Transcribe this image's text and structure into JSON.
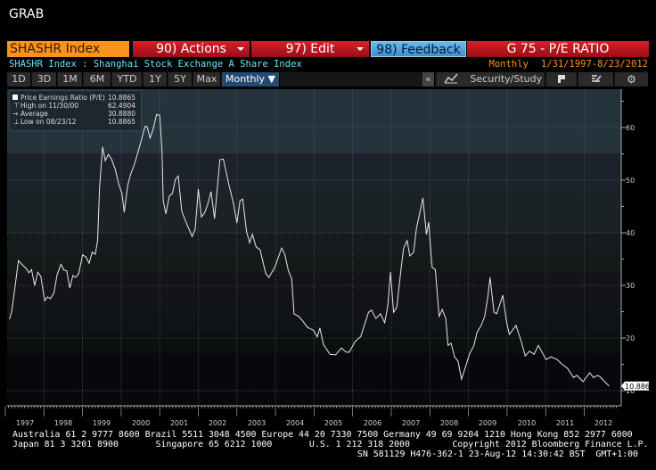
{
  "window_title": "GRAB",
  "toolbar": {
    "ticker": "SHASHR Index",
    "actions_label": "90) Actions",
    "edit_label": "97) Edit",
    "feedback_label": "98) Feedback",
    "function_title": "G 75 - P/E RATIO"
  },
  "subheader": {
    "description": "SHASHR Index : Shanghai Stock Exchange A Share Index",
    "periodicity": "Monthly",
    "date_range": "1/31/1997-8/23/2012"
  },
  "range_buttons": [
    "1D",
    "3D",
    "1M",
    "6M",
    "YTD",
    "1Y",
    "5Y",
    "Max"
  ],
  "period_select": "Monthly ▼",
  "right_tools": {
    "collapse": "«",
    "security_study": "Security/Study",
    "icons": [
      "line-chart-icon",
      "flag-icon",
      "edit-icon",
      "gear-icon"
    ]
  },
  "legend": {
    "series": {
      "label": "Price Earnings Ratio (P/E)",
      "value": "10.8865"
    },
    "high": {
      "label": "High on 11/30/00",
      "value": "62.4904"
    },
    "average": {
      "label": "Average",
      "value": "30.8880"
    },
    "low": {
      "label": "Low on 08/23/12",
      "value": "10.8865"
    }
  },
  "last_value_tag": "10.8865",
  "footer": {
    "line1": "Australia 61 2 9777 8600 Brazil 5511 3048 4500 Europe 44 20 7330 7500 Germany 49 69 9204 1210 Hong Kong 852 2977 6000",
    "line2": "Japan 81 3 3201 8900       Singapore 65 6212 1000       U.S. 1 212 318 2000        Copyright 2012 Bloomberg Finance L.P.",
    "line3": "SN 581129 H476-362-1 23-Aug-12 14:30:42 BST  GMT+1:00"
  },
  "colors": {
    "line": "#e8e8e8",
    "orange": "#f7931e",
    "red": "#c0151f",
    "blue": "#4a9ee0",
    "cyan": "#6fe0f0"
  },
  "chart_data": {
    "type": "line",
    "title": "",
    "xlabel": "",
    "ylabel": "",
    "x_ticks": [
      "1997",
      "1998",
      "1999",
      "2000",
      "2001",
      "2002",
      "2003",
      "2004",
      "2005",
      "2006",
      "2007",
      "2008",
      "2009",
      "2010",
      "2011",
      "2012"
    ],
    "y_ticks": [
      "10",
      "20",
      "30",
      "40",
      "50",
      "60"
    ],
    "ylim": [
      7,
      67
    ],
    "xlim": [
      1997,
      2012.9
    ],
    "y_axis_side": "right",
    "grid": true,
    "legend_position": "top-left",
    "series": [
      {
        "name": "Price Earnings Ratio (P/E)",
        "points": [
          [
            1997.11,
            23.6
          ],
          [
            1997.17,
            25.3
          ],
          [
            1997.34,
            34.7
          ],
          [
            1997.44,
            33.9
          ],
          [
            1997.54,
            33.2
          ],
          [
            1997.61,
            32.4
          ],
          [
            1997.68,
            33.0
          ],
          [
            1997.76,
            30.0
          ],
          [
            1997.84,
            32.5
          ],
          [
            1997.92,
            31.7
          ],
          [
            1998.02,
            27.1
          ],
          [
            1998.09,
            27.8
          ],
          [
            1998.17,
            27.5
          ],
          [
            1998.26,
            28.6
          ],
          [
            1998.34,
            32.0
          ],
          [
            1998.44,
            34.0
          ],
          [
            1998.52,
            32.9
          ],
          [
            1998.59,
            32.8
          ],
          [
            1998.67,
            29.5
          ],
          [
            1998.75,
            31.9
          ],
          [
            1998.82,
            31.5
          ],
          [
            1998.9,
            32.2
          ],
          [
            1999.0,
            35.8
          ],
          [
            1999.09,
            35.4
          ],
          [
            1999.17,
            34.2
          ],
          [
            1999.25,
            36.3
          ],
          [
            1999.33,
            35.9
          ],
          [
            1999.39,
            38.5
          ],
          [
            1999.44,
            48.6
          ],
          [
            1999.52,
            56.3
          ],
          [
            1999.59,
            53.7
          ],
          [
            1999.67,
            54.9
          ],
          [
            1999.75,
            54.0
          ],
          [
            1999.85,
            52.0
          ],
          [
            1999.94,
            49.2
          ],
          [
            2000.02,
            47.5
          ],
          [
            2000.08,
            43.9
          ],
          [
            2000.17,
            49.0
          ],
          [
            2000.25,
            51.2
          ],
          [
            2000.34,
            52.9
          ],
          [
            2000.42,
            54.9
          ],
          [
            2000.52,
            57.5
          ],
          [
            2000.62,
            60.2
          ],
          [
            2000.67,
            60.2
          ],
          [
            2000.75,
            58.0
          ],
          [
            2000.83,
            59.7
          ],
          [
            2000.92,
            62.5
          ],
          [
            2001.0,
            62.3
          ],
          [
            2001.06,
            55.4
          ],
          [
            2001.09,
            46.1
          ],
          [
            2001.16,
            43.6
          ],
          [
            2001.25,
            47.0
          ],
          [
            2001.33,
            47.5
          ],
          [
            2001.4,
            50.0
          ],
          [
            2001.48,
            50.8
          ],
          [
            2001.57,
            44.1
          ],
          [
            2001.71,
            41.5
          ],
          [
            2001.84,
            39.3
          ],
          [
            2001.92,
            40.7
          ],
          [
            2002.0,
            48.3
          ],
          [
            2002.08,
            43.0
          ],
          [
            2002.17,
            43.9
          ],
          [
            2002.25,
            45.6
          ],
          [
            2002.33,
            47.8
          ],
          [
            2002.42,
            42.7
          ],
          [
            2002.56,
            53.9
          ],
          [
            2002.65,
            54.0
          ],
          [
            2002.79,
            49.2
          ],
          [
            2002.91,
            45.6
          ],
          [
            2003.0,
            41.9
          ],
          [
            2003.08,
            46.1
          ],
          [
            2003.15,
            46.4
          ],
          [
            2003.25,
            40.2
          ],
          [
            2003.33,
            38.1
          ],
          [
            2003.4,
            39.7
          ],
          [
            2003.5,
            37.3
          ],
          [
            2003.6,
            36.8
          ],
          [
            2003.67,
            34.6
          ],
          [
            2003.75,
            32.2
          ],
          [
            2003.83,
            31.5
          ],
          [
            2003.98,
            33.4
          ],
          [
            2004.16,
            37.1
          ],
          [
            2004.24,
            35.9
          ],
          [
            2004.33,
            32.9
          ],
          [
            2004.42,
            31.2
          ],
          [
            2004.48,
            24.6
          ],
          [
            2004.6,
            24.1
          ],
          [
            2004.71,
            23.2
          ],
          [
            2004.83,
            22.0
          ],
          [
            2004.98,
            21.5
          ],
          [
            2005.08,
            20.2
          ],
          [
            2005.15,
            21.9
          ],
          [
            2005.24,
            18.8
          ],
          [
            2005.41,
            16.9
          ],
          [
            2005.56,
            16.8
          ],
          [
            2005.71,
            18.1
          ],
          [
            2005.83,
            17.3
          ],
          [
            2005.91,
            17.3
          ],
          [
            2006.06,
            19.3
          ],
          [
            2006.21,
            20.3
          ],
          [
            2006.41,
            24.9
          ],
          [
            2006.49,
            25.3
          ],
          [
            2006.6,
            23.7
          ],
          [
            2006.72,
            24.6
          ],
          [
            2006.83,
            22.9
          ],
          [
            2006.91,
            26.1
          ],
          [
            2006.98,
            32.5
          ],
          [
            2007.06,
            24.9
          ],
          [
            2007.14,
            25.8
          ],
          [
            2007.25,
            32.9
          ],
          [
            2007.32,
            37.1
          ],
          [
            2007.41,
            38.5
          ],
          [
            2007.48,
            35.6
          ],
          [
            2007.58,
            36.3
          ],
          [
            2007.65,
            40.7
          ],
          [
            2007.82,
            46.6
          ],
          [
            2007.91,
            39.7
          ],
          [
            2007.97,
            42.0
          ],
          [
            2008.04,
            35.1
          ],
          [
            2008.06,
            33.4
          ],
          [
            2008.14,
            33.0
          ],
          [
            2008.24,
            24.1
          ],
          [
            2008.32,
            25.4
          ],
          [
            2008.41,
            23.7
          ],
          [
            2008.47,
            18.6
          ],
          [
            2008.55,
            19.0
          ],
          [
            2008.64,
            16.4
          ],
          [
            2008.73,
            15.6
          ],
          [
            2008.82,
            12.2
          ],
          [
            2008.91,
            14.2
          ],
          [
            2009.03,
            17.0
          ],
          [
            2009.14,
            18.6
          ],
          [
            2009.22,
            21.0
          ],
          [
            2009.33,
            22.4
          ],
          [
            2009.42,
            24.1
          ],
          [
            2009.5,
            27.8
          ],
          [
            2009.56,
            31.5
          ],
          [
            2009.66,
            24.9
          ],
          [
            2009.73,
            24.6
          ],
          [
            2009.89,
            28.1
          ],
          [
            2009.99,
            22.9
          ],
          [
            2010.06,
            20.7
          ],
          [
            2010.23,
            22.4
          ],
          [
            2010.37,
            19.3
          ],
          [
            2010.47,
            16.6
          ],
          [
            2010.58,
            17.5
          ],
          [
            2010.7,
            16.9
          ],
          [
            2010.81,
            18.6
          ],
          [
            2011.01,
            15.9
          ],
          [
            2011.14,
            16.4
          ],
          [
            2011.3,
            15.9
          ],
          [
            2011.41,
            15.1
          ],
          [
            2011.57,
            14.2
          ],
          [
            2011.72,
            12.5
          ],
          [
            2011.81,
            12.9
          ],
          [
            2011.97,
            11.7
          ],
          [
            2012.14,
            13.4
          ],
          [
            2012.24,
            12.5
          ],
          [
            2012.34,
            12.9
          ],
          [
            2012.4,
            12.7
          ],
          [
            2012.64,
            10.8865
          ]
        ]
      }
    ]
  }
}
